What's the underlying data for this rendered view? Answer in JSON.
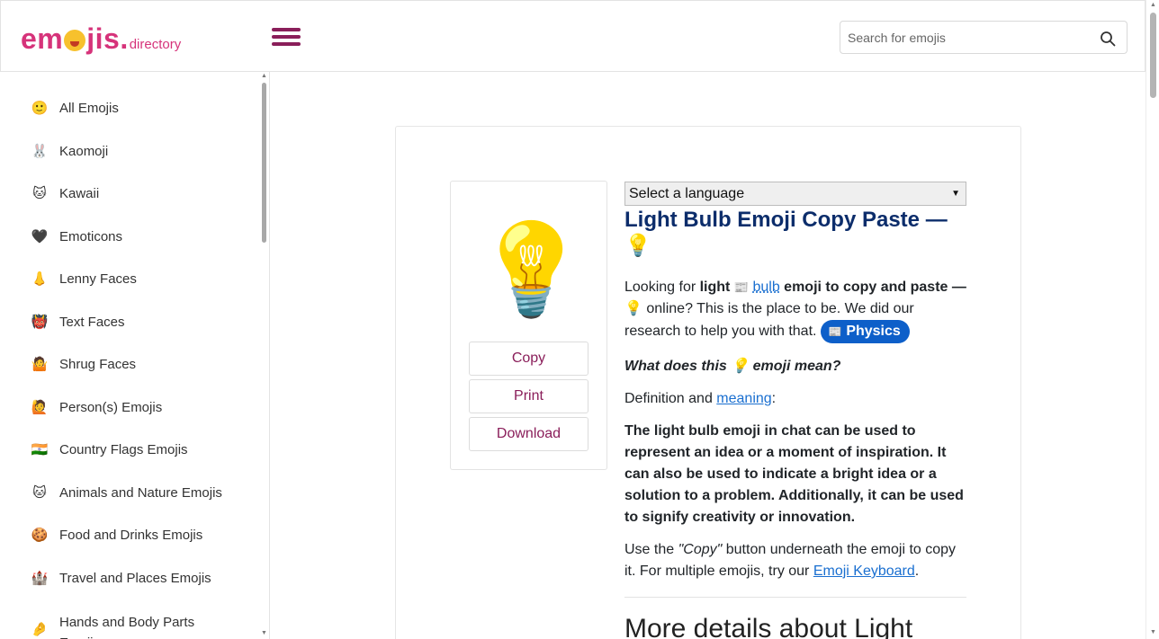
{
  "header": {
    "logo_main_1": "em",
    "logo_main_2": "jis.",
    "logo_sub": "directory",
    "search_placeholder": "Search for emojis"
  },
  "sidebar": {
    "items": [
      {
        "icon": "🙂",
        "label": "All Emojis"
      },
      {
        "icon": "🐰",
        "label": "Kaomoji"
      },
      {
        "icon": "🐱",
        "label": "Kawaii"
      },
      {
        "icon": "🖤",
        "label": "Emoticons"
      },
      {
        "icon": "👃",
        "label": "Lenny Faces"
      },
      {
        "icon": "👹",
        "label": "Text Faces"
      },
      {
        "icon": "🤷",
        "label": "Shrug Faces"
      },
      {
        "icon": "🙋",
        "label": "Person(s) Emojis"
      },
      {
        "icon": "🇮🇳",
        "label": "Country Flags Emojis"
      },
      {
        "icon": "🐱",
        "label": "Animals and Nature Emojis"
      },
      {
        "icon": "🍪",
        "label": "Food and Drinks Emojis"
      },
      {
        "icon": "🏰",
        "label": "Travel and Places Emojis"
      },
      {
        "icon": "🤌",
        "label": "Hands and Body Parts Emojis"
      }
    ]
  },
  "emoji": {
    "glyph": "💡",
    "copy_label": "Copy",
    "print_label": "Print",
    "download_label": "Download"
  },
  "content": {
    "language_select": "Select a language",
    "title": "Light Bulb Emoji Copy Paste — 💡",
    "intro_1": "Looking for ",
    "intro_light": "light",
    "intro_bulb_icon": "📰",
    "intro_bulb": "bulb",
    "intro_2": " emoji to copy and paste — ",
    "intro_glyph": "💡",
    "intro_3": " online? This is the place to be. We did our research to help you with that. ",
    "physics_icon": "📰",
    "physics_label": "Physics",
    "question_1": "What does this ",
    "question_glyph": "💡",
    "question_2": " emoji mean?",
    "definition_prefix": "Definition and ",
    "definition_link": "meaning",
    "definition_suffix": ":",
    "meaning_text": "The light bulb emoji in chat can be used to represent an idea or a moment of inspiration. It can also be used to indicate a bright idea or a solution to a problem. Additionally, it can be used to signify creativity or innovation.",
    "use_1": "Use the ",
    "use_copy": "\"Copy\"",
    "use_2": " button underneath the emoji to copy it. For multiple emojis, try our ",
    "use_link": "Emoji Keyboard",
    "use_3": ".",
    "more_details": "More details about Light"
  },
  "colors": {
    "brand": "#d6337a",
    "title": "#0c2d6b",
    "link": "#1a6fd0",
    "pill": "#0d5fc9",
    "button_text": "#8a1e5a"
  }
}
